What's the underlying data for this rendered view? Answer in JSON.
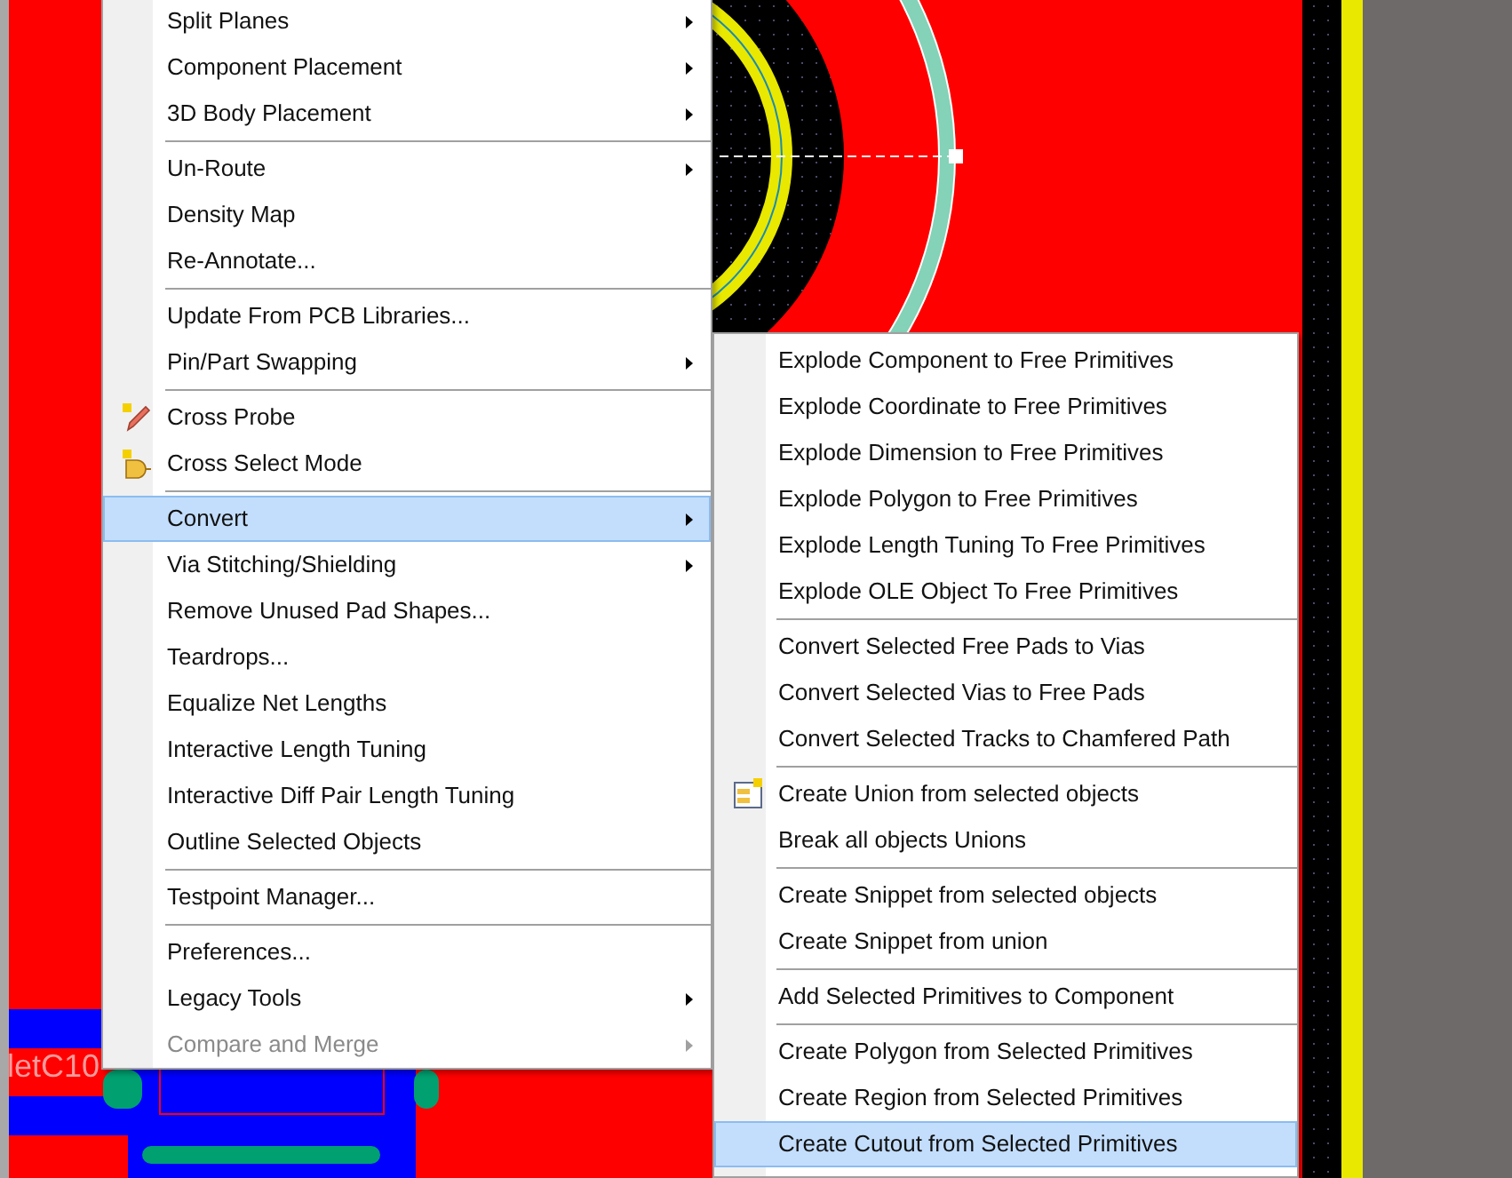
{
  "canvas": {
    "net_label": "letC10"
  },
  "context_menu": {
    "items": [
      {
        "kind": "item",
        "label": "Split Planes",
        "submenu": true,
        "selected": false,
        "disabled": false
      },
      {
        "kind": "item",
        "label": "Component Placement",
        "submenu": true,
        "selected": false,
        "disabled": false
      },
      {
        "kind": "item",
        "label": "3D Body Placement",
        "submenu": true,
        "selected": false,
        "disabled": false
      },
      {
        "kind": "separator"
      },
      {
        "kind": "item",
        "label": "Un-Route",
        "submenu": true,
        "selected": false,
        "disabled": false
      },
      {
        "kind": "item",
        "label": "Density Map",
        "submenu": false,
        "selected": false,
        "disabled": false
      },
      {
        "kind": "item",
        "label": "Re-Annotate...",
        "submenu": false,
        "selected": false,
        "disabled": false
      },
      {
        "kind": "separator"
      },
      {
        "kind": "item",
        "label": "Update From PCB Libraries...",
        "submenu": false,
        "selected": false,
        "disabled": false
      },
      {
        "kind": "item",
        "label": "Pin/Part Swapping",
        "submenu": true,
        "selected": false,
        "disabled": false
      },
      {
        "kind": "separator"
      },
      {
        "kind": "item",
        "label": "Cross Probe",
        "submenu": false,
        "selected": false,
        "disabled": false
      },
      {
        "kind": "item",
        "label": "Cross Select Mode",
        "submenu": false,
        "selected": false,
        "disabled": false
      },
      {
        "kind": "separator"
      },
      {
        "kind": "item",
        "label": "Convert",
        "submenu": true,
        "selected": true,
        "disabled": false
      },
      {
        "kind": "item",
        "label": "Via Stitching/Shielding",
        "submenu": true,
        "selected": false,
        "disabled": false
      },
      {
        "kind": "item",
        "label": "Remove Unused Pad Shapes...",
        "submenu": false,
        "selected": false,
        "disabled": false
      },
      {
        "kind": "item",
        "label": "Teardrops...",
        "submenu": false,
        "selected": false,
        "disabled": false
      },
      {
        "kind": "item",
        "label": "Equalize Net Lengths",
        "submenu": false,
        "selected": false,
        "disabled": false
      },
      {
        "kind": "item",
        "label": "Interactive Length Tuning",
        "submenu": false,
        "selected": false,
        "disabled": false
      },
      {
        "kind": "item",
        "label": "Interactive Diff Pair Length Tuning",
        "submenu": false,
        "selected": false,
        "disabled": false
      },
      {
        "kind": "item",
        "label": "Outline Selected Objects",
        "submenu": false,
        "selected": false,
        "disabled": false
      },
      {
        "kind": "separator"
      },
      {
        "kind": "item",
        "label": "Testpoint Manager...",
        "submenu": false,
        "selected": false,
        "disabled": false
      },
      {
        "kind": "separator"
      },
      {
        "kind": "item",
        "label": "Preferences...",
        "submenu": false,
        "selected": false,
        "disabled": false
      },
      {
        "kind": "item",
        "label": "Legacy Tools",
        "submenu": true,
        "selected": false,
        "disabled": false
      },
      {
        "kind": "item",
        "label": "Compare and Merge",
        "submenu": true,
        "selected": false,
        "disabled": true
      }
    ]
  },
  "submenu": {
    "items": [
      {
        "kind": "item",
        "label": "Explode Component to Free Primitives",
        "selected": false
      },
      {
        "kind": "item",
        "label": "Explode Coordinate to Free Primitives",
        "selected": false
      },
      {
        "kind": "item",
        "label": "Explode Dimension to Free Primitives",
        "selected": false
      },
      {
        "kind": "item",
        "label": "Explode Polygon to Free Primitives",
        "selected": false
      },
      {
        "kind": "item",
        "label": "Explode Length Tuning To Free Primitives",
        "selected": false
      },
      {
        "kind": "item",
        "label": "Explode OLE Object To Free Primitives",
        "selected": false
      },
      {
        "kind": "separator"
      },
      {
        "kind": "item",
        "label": "Convert Selected Free Pads to Vias",
        "selected": false
      },
      {
        "kind": "item",
        "label": "Convert Selected Vias to Free Pads",
        "selected": false
      },
      {
        "kind": "item",
        "label": "Convert Selected Tracks to Chamfered Path",
        "selected": false
      },
      {
        "kind": "separator"
      },
      {
        "kind": "item",
        "label": "Create Union from selected objects",
        "selected": false
      },
      {
        "kind": "item",
        "label": "Break all objects Unions",
        "selected": false
      },
      {
        "kind": "separator"
      },
      {
        "kind": "item",
        "label": "Create Snippet from selected objects",
        "selected": false
      },
      {
        "kind": "item",
        "label": "Create Snippet from union",
        "selected": false
      },
      {
        "kind": "separator"
      },
      {
        "kind": "item",
        "label": "Add Selected Primitives to Component",
        "selected": false
      },
      {
        "kind": "separator"
      },
      {
        "kind": "item",
        "label": "Create Polygon from Selected Primitives",
        "selected": false
      },
      {
        "kind": "item",
        "label": "Create Region from Selected Primitives",
        "selected": false
      },
      {
        "kind": "item",
        "label": "Create Cutout from Selected Primitives",
        "selected": true
      }
    ]
  }
}
